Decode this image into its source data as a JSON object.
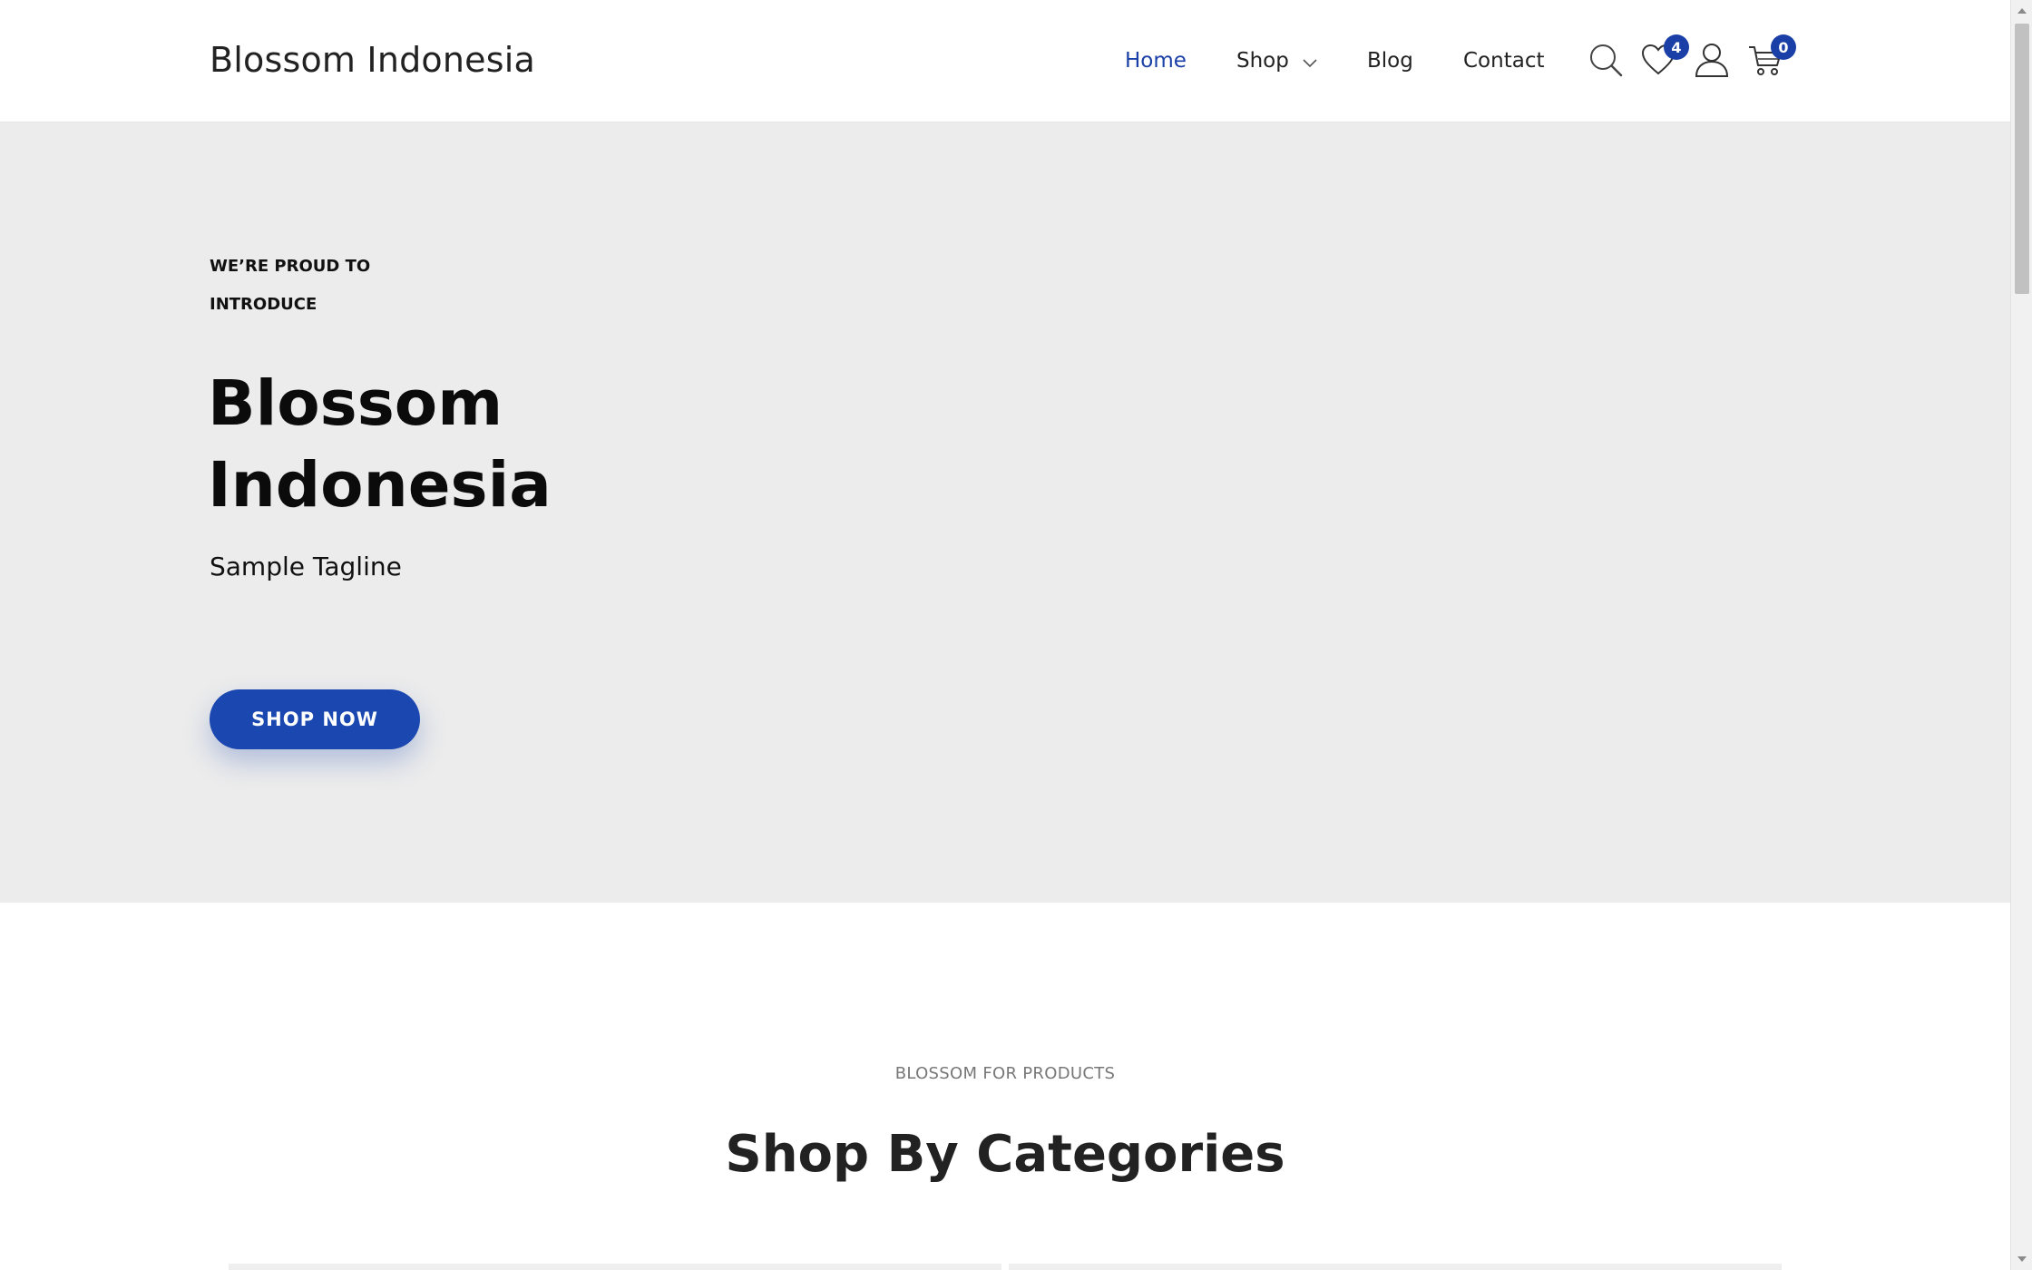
{
  "header": {
    "logo": "Blossom Indonesia",
    "nav": {
      "home": "Home",
      "shop": "Shop",
      "blog": "Blog",
      "contact": "Contact"
    },
    "wishlist_count": "4",
    "cart_count": "0",
    "icons": [
      "search-icon",
      "heart-icon",
      "user-icon",
      "cart-icon"
    ]
  },
  "hero": {
    "eyebrow": "WE’RE PROUD TO INTRODUCE",
    "title": "Blossom Indonesia",
    "tagline": "Sample Tagline",
    "cta": "SHOP NOW"
  },
  "categories": {
    "eyebrow": "BLOSSOM FOR PRODUCTS",
    "title": "Shop By Categories"
  },
  "colors": {
    "accent": "#1a47b0",
    "active_nav": "#1a3fa6",
    "hero_bg": "#ececec"
  }
}
